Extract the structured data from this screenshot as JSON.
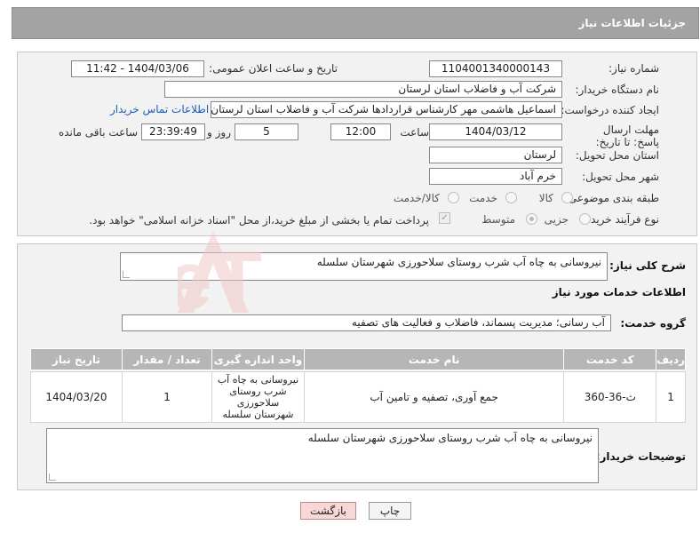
{
  "header": {
    "title": "جزئیات اطلاعات نیاز"
  },
  "form": {
    "need_number_label": "شماره نیاز:",
    "need_number": "1104001340000143",
    "announce_label": "تاریخ و ساعت اعلان عمومی:",
    "announce_value": "1404/03/06 - 11:42",
    "buyer_org_label": "نام دستگاه خریدار:",
    "buyer_org": "شرکت آب و فاضلاب استان لرستان",
    "creator_label": "ایجاد کننده درخواست:",
    "creator": "اسماعیل هاشمی مهر کارشناس قراردادها شرکت آب و فاضلاب استان لرستان",
    "contact_link": "اطلاعات تماس خریدار",
    "deadline_label": "مهلت ارسال پاسخ: تا تاریخ:",
    "deadline_date": "1404/03/12",
    "time_label": "ساعت",
    "deadline_time": "12:00",
    "days_value": "5",
    "days_label": "روز و",
    "remaining_time": "23:39:49",
    "remaining_label": "ساعت باقی مانده",
    "province_label": "استان محل تحویل:",
    "province": "لرستان",
    "city_label": "شهر محل تحویل:",
    "city": "خرم آباد",
    "category_label": "طبقه بندی موضوعی:",
    "category_options": [
      "کالا",
      "خدمت",
      "کالا/خدمت"
    ],
    "purchase_type_label": "نوع فرآیند خرید :",
    "purchase_options": [
      "جزیی",
      "متوسط"
    ],
    "payment_note": "پرداخت تمام یا بخشی از مبلغ خرید،از محل \"اسناد خزانه اسلامی\" خواهد بود."
  },
  "details": {
    "summary_label": "شرح کلی نیاز:",
    "summary": "نیروسانی به چاه آب شرب روستای سلاحورزی شهرستان سلسله",
    "services_heading": "اطلاعات خدمات مورد نیاز",
    "service_group_label": "گروه خدمت:",
    "service_group": "آب رسانی؛ مدیریت پسماند، فاضلاب و فعالیت های تصفیه",
    "table": {
      "headers": [
        "ردیف",
        "کد خدمت",
        "نام خدمت",
        "واحد اندازه گیری",
        "تعداد / مقدار",
        "تاریخ نیاز"
      ],
      "rows": [
        [
          "1",
          "ث-36-360",
          "جمع آوری، تصفیه و تامین آب",
          "نیروسانی به چاه آب شرب روستای سلاحورزی شهرستان سلسله",
          "1",
          "1404/03/20"
        ]
      ]
    },
    "buyer_notes_label": "توضیحات خریدار:",
    "buyer_notes": "نیروسانی به چاه آب شرب روستای سلاحورزی شهرستان سلسله"
  },
  "buttons": {
    "print": "چاپ",
    "back": "بازگشت"
  },
  "watermark": {
    "text": "AriaTender.neT",
    "color": "#f0c8c8"
  }
}
